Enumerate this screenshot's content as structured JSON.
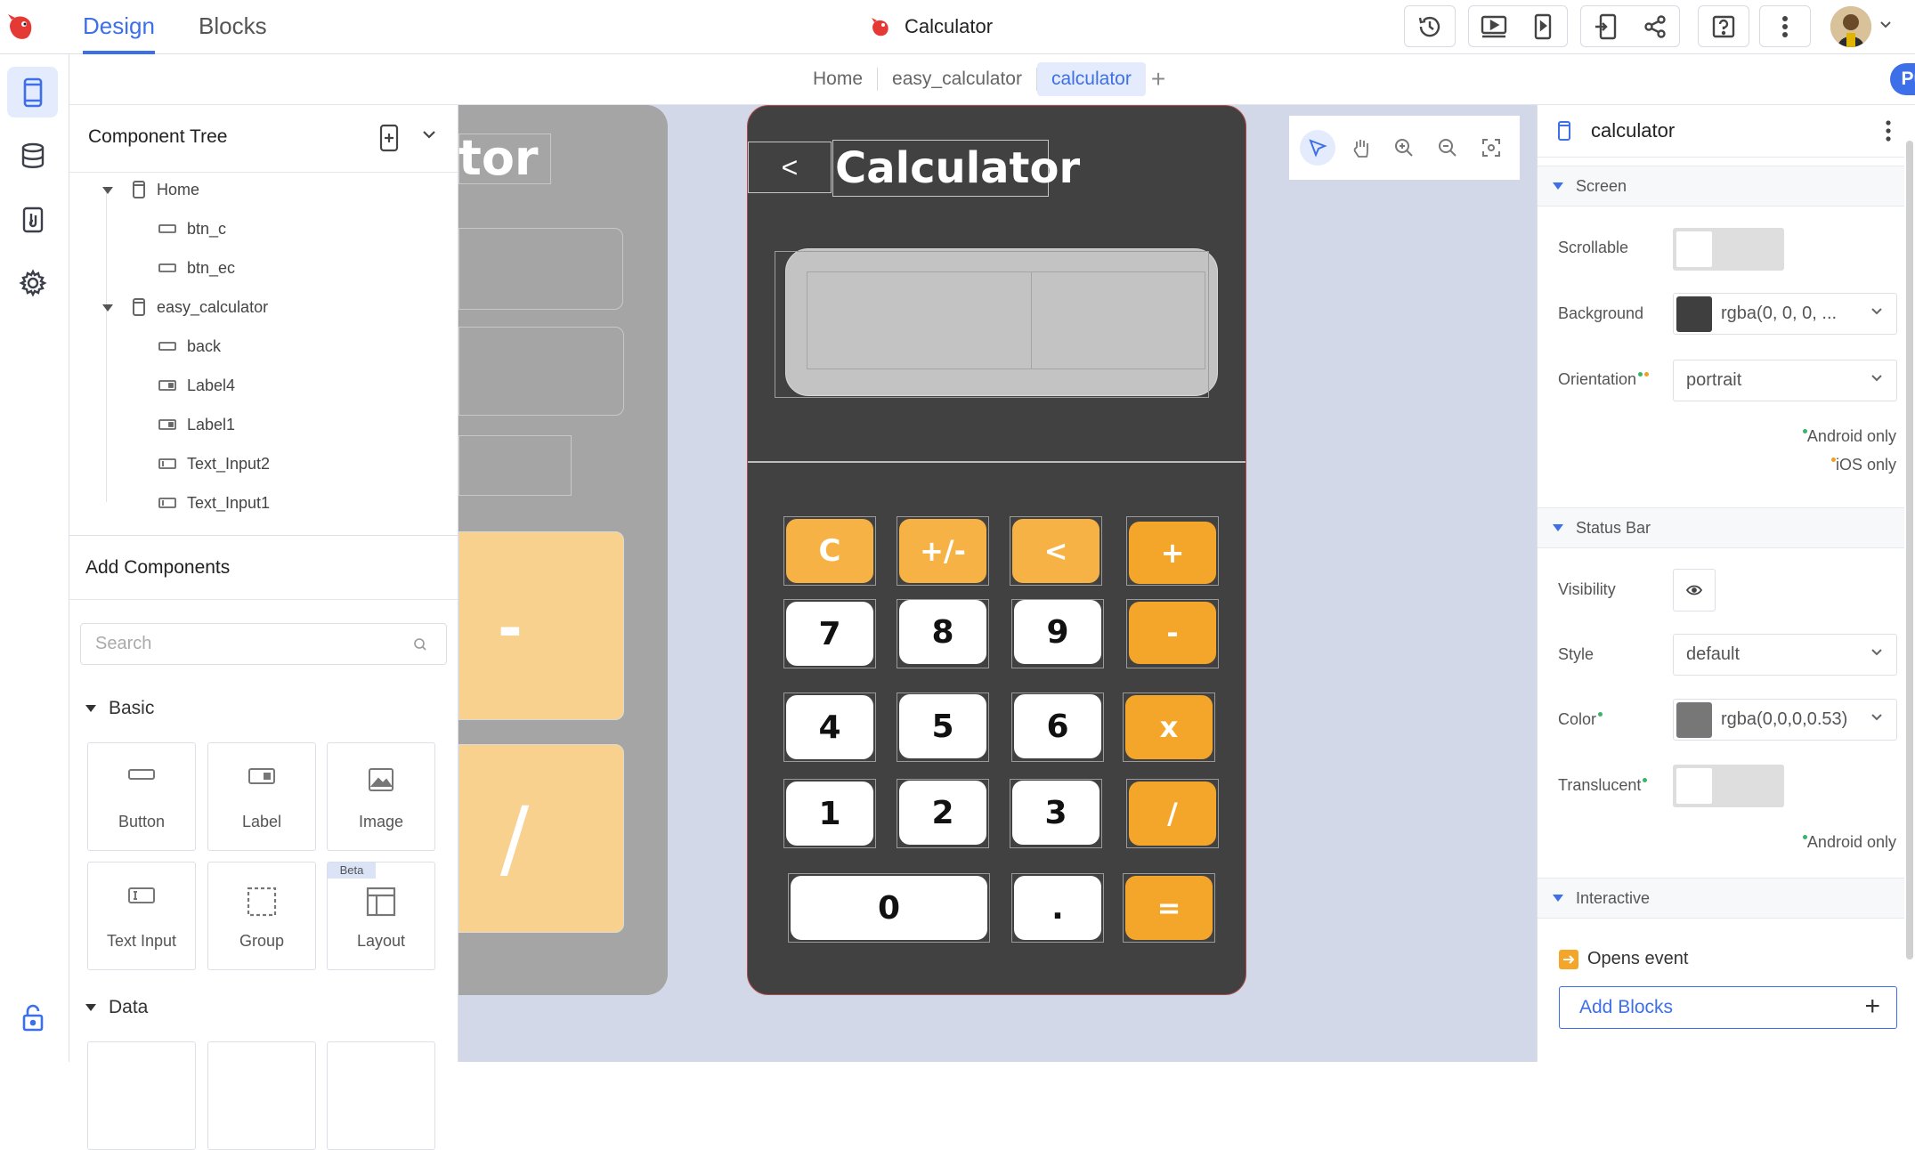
{
  "topbar": {
    "tabs": [
      "Design",
      "Blocks"
    ],
    "project_name": "Calculator"
  },
  "crumbs": {
    "items": [
      "Home",
      "easy_calculator",
      "calculator"
    ],
    "public_label": "Public"
  },
  "tree": {
    "title": "Component Tree",
    "nodes": [
      "Home",
      "btn_c",
      "btn_ec",
      "easy_calculator",
      "back",
      "Label4",
      "Label1",
      "Text_Input2",
      "Text_Input1"
    ]
  },
  "add_components": {
    "title": "Add Components",
    "search_placeholder": "Search",
    "basic_label": "Basic",
    "data_label": "Data",
    "cards": [
      "Button",
      "Label",
      "Image",
      "Text Input",
      "Group",
      "Layout"
    ],
    "beta_label": "Beta"
  },
  "canvas": {
    "ghost_title": "tor",
    "ghost_keys": [
      "-",
      "/"
    ],
    "back_label": "<",
    "title": "Calculator",
    "display_value": "",
    "keys": [
      "C",
      "+/-",
      "<",
      "+",
      "7",
      "8",
      "9",
      "-",
      "4",
      "5",
      "6",
      "x",
      "1",
      "2",
      "3",
      "/",
      "0",
      ".",
      "="
    ]
  },
  "props": {
    "title": "calculator",
    "sections": {
      "screen": "Screen",
      "status_bar": "Status Bar",
      "interactive": "Interactive"
    },
    "scrollable_label": "Scrollable",
    "background_label": "Background",
    "background_value": "rgba(0, 0, 0, ...",
    "background_color": "#3f3f3f",
    "orientation_label": "Orientation",
    "orientation_value": "portrait",
    "android_only": "Android only",
    "ios_only": "iOS only",
    "visibility_label": "Visibility",
    "style_label": "Style",
    "style_value": "default",
    "color_label": "Color",
    "color_value": "rgba(0,0,0,0.53)",
    "color_swatch": "#777777",
    "translucent_label": "Translucent",
    "android_only_2": "Android only",
    "opens_event": "Opens event",
    "add_blocks": "Add Blocks"
  },
  "colors": {
    "accent": "#3d6fe8",
    "key_orange": "#f4a62a",
    "phone_bg": "#424141"
  }
}
